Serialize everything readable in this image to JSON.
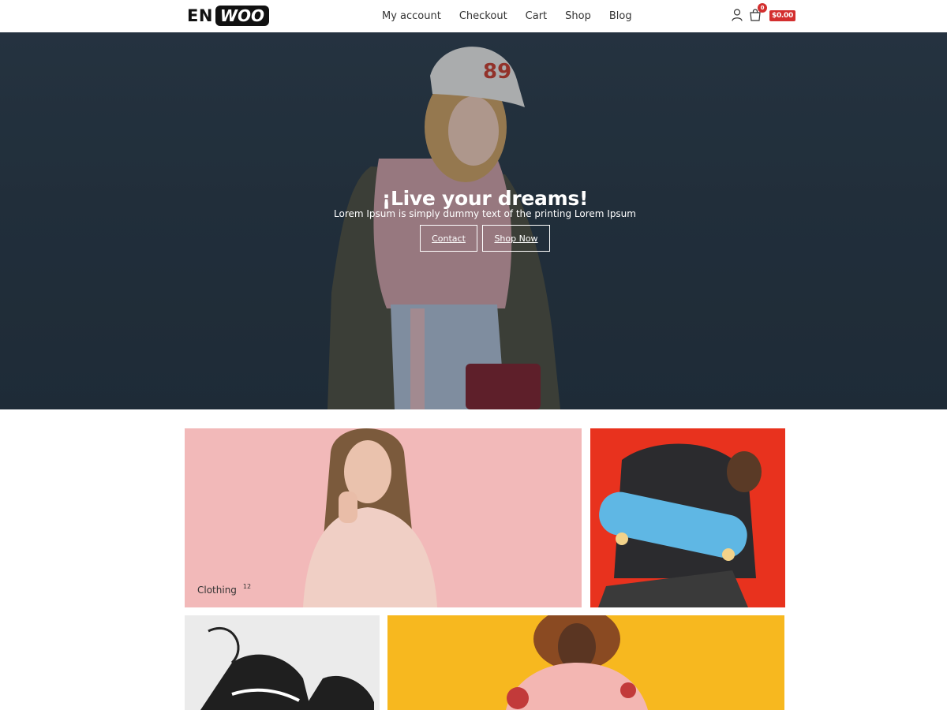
{
  "logo": {
    "part1": "EN",
    "part2": "WOO"
  },
  "nav": {
    "items": [
      {
        "label": "My account"
      },
      {
        "label": "Checkout"
      },
      {
        "label": "Cart"
      },
      {
        "label": "Shop"
      },
      {
        "label": "Blog"
      }
    ]
  },
  "cart": {
    "count": "0",
    "total": "$0.00"
  },
  "hero": {
    "title": "¡Live your dreams!",
    "subtitle": "Lorem Ipsum is simply dummy text of the printing Lorem Ipsum",
    "buttons": {
      "contact": "Contact",
      "shop_now": "Shop Now"
    }
  },
  "categories": [
    {
      "name": "Clothing",
      "count": "12"
    }
  ],
  "icons": {
    "user": "user-icon",
    "cart": "shopping-bag-icon"
  },
  "colors": {
    "accent": "#d32f2f",
    "hero_bg": "#263441"
  }
}
